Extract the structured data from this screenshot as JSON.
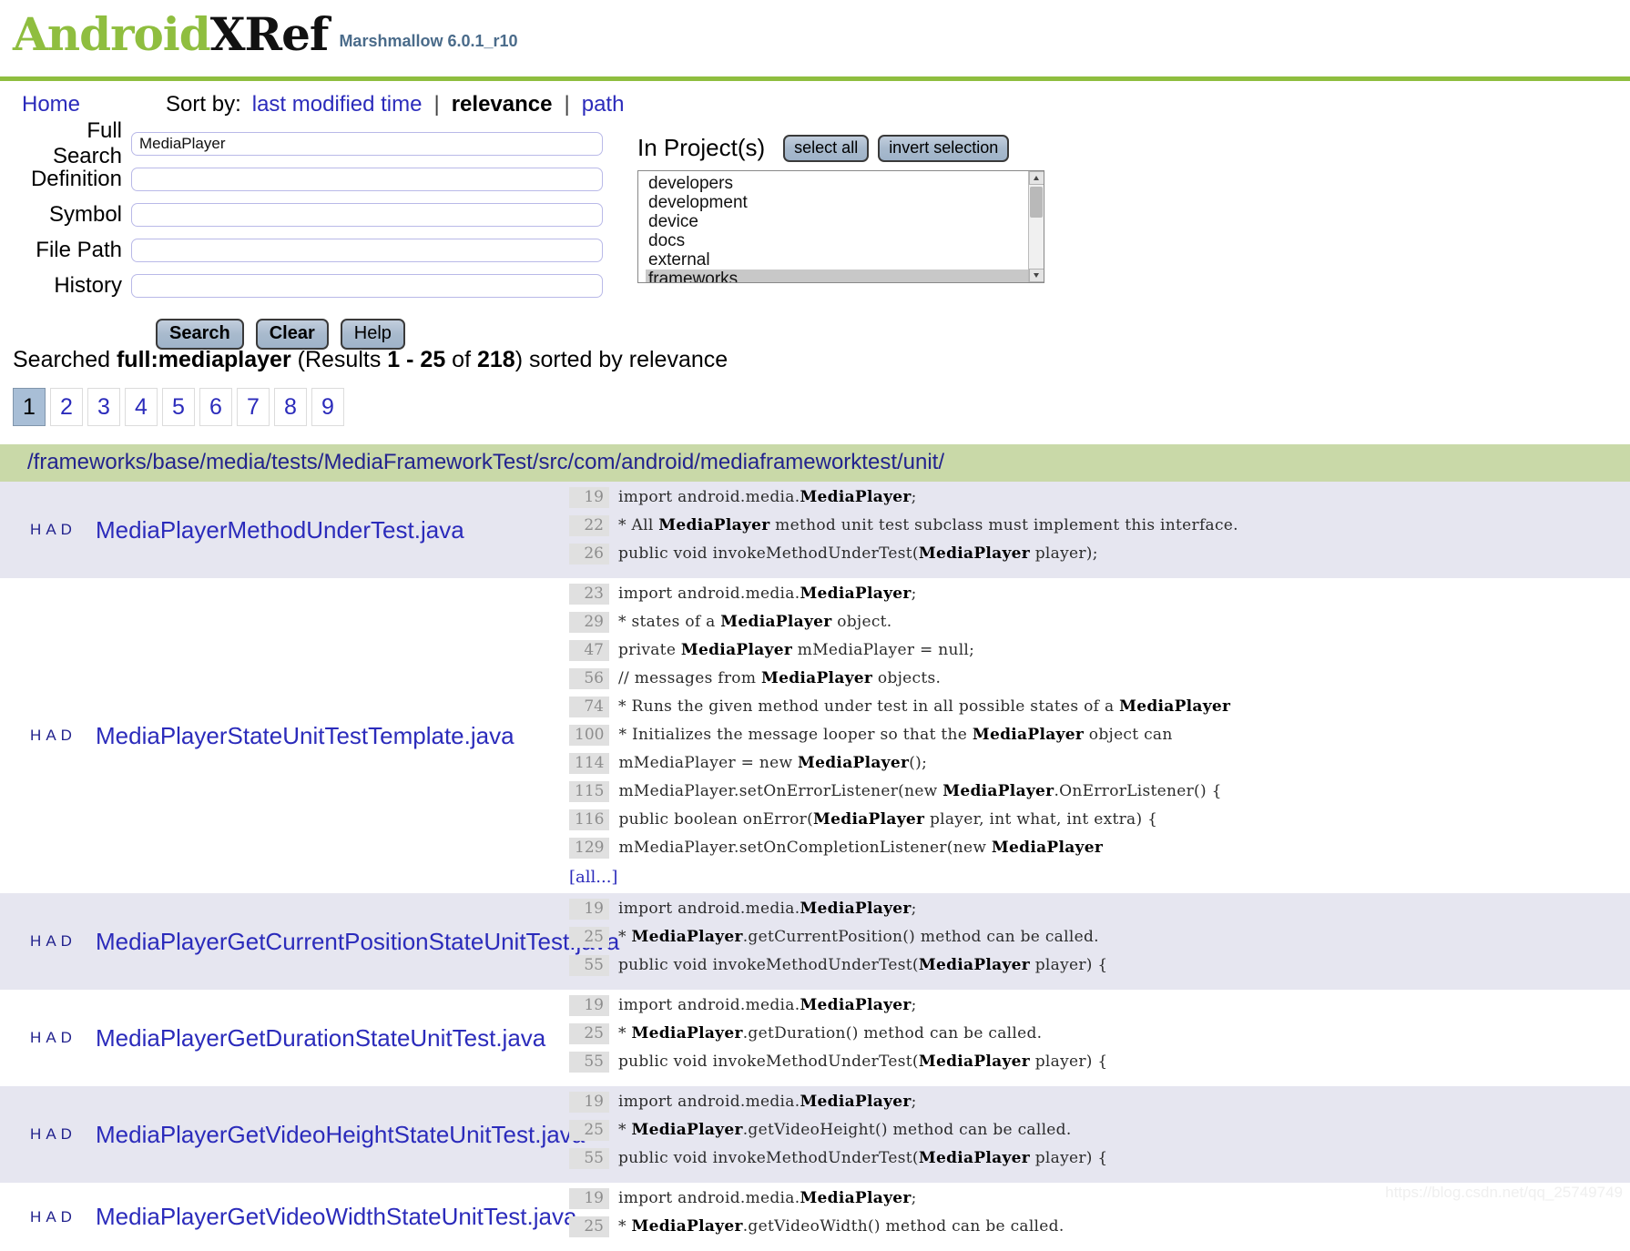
{
  "header": {
    "logo_primary": "Android",
    "logo_secondary": "XRef",
    "version": "Marshmallow 6.0.1_r10",
    "brand_color": "#8fbe3f"
  },
  "nav": {
    "home": "Home",
    "sort_label": "Sort by:",
    "sort_options": [
      {
        "label": "last modified time",
        "current": false
      },
      {
        "label": "relevance",
        "current": true
      },
      {
        "label": "path",
        "current": false
      }
    ],
    "separator": "|"
  },
  "search_form": {
    "fields": [
      {
        "label": "Full Search",
        "value": "MediaPlayer",
        "placeholder": ""
      },
      {
        "label": "Definition",
        "value": "",
        "placeholder": ""
      },
      {
        "label": "Symbol",
        "value": "",
        "placeholder": ""
      },
      {
        "label": "File Path",
        "value": "",
        "placeholder": ""
      },
      {
        "label": "History",
        "value": "",
        "placeholder": ""
      }
    ],
    "buttons": [
      {
        "label": "Search",
        "bold": true
      },
      {
        "label": "Clear",
        "bold": true
      },
      {
        "label": "Help",
        "bold": false
      }
    ]
  },
  "projects": {
    "title": "In Project(s)",
    "select_all": "select all",
    "invert_selection": "invert selection",
    "items": [
      {
        "label": "developers",
        "selected": false
      },
      {
        "label": "development",
        "selected": false
      },
      {
        "label": "device",
        "selected": false
      },
      {
        "label": "docs",
        "selected": false
      },
      {
        "label": "external",
        "selected": false
      },
      {
        "label": "frameworks",
        "selected": true
      }
    ]
  },
  "summary": {
    "prefix": "Searched ",
    "query": "full:mediaplayer",
    "results_open": " (Results ",
    "range": "1 - 25",
    "of": " of ",
    "total": "218",
    "suffix": ") sorted by relevance"
  },
  "pagination": {
    "pages": [
      "1",
      "2",
      "3",
      "4",
      "5",
      "6",
      "7",
      "8",
      "9"
    ],
    "current": "1"
  },
  "results": {
    "directory": "/frameworks/base/media/tests/MediaFrameworkTest/src/com/android/mediaframeworktest/unit/",
    "markers": [
      "H",
      "A",
      "D"
    ],
    "more_label": "[all...]",
    "rows": [
      {
        "file": "MediaPlayerMethodUnderTest.java",
        "alt": true,
        "more": false,
        "lines": [
          {
            "num": "19",
            "pre": "import android.media.",
            "hit": "MediaPlayer",
            "post": ";"
          },
          {
            "num": "22",
            "pre": "* All ",
            "hit": "MediaPlayer",
            "post": " method unit test subclass must implement this interface."
          },
          {
            "num": "26",
            "pre": "public void invokeMethodUnderTest(",
            "hit": "MediaPlayer",
            "post": " player);"
          }
        ]
      },
      {
        "file": "MediaPlayerStateUnitTestTemplate.java",
        "alt": false,
        "more": true,
        "lines": [
          {
            "num": "23",
            "pre": "import android.media.",
            "hit": "MediaPlayer",
            "post": ";"
          },
          {
            "num": "29",
            "pre": "* states of a ",
            "hit": "MediaPlayer",
            "post": " object."
          },
          {
            "num": "47",
            "pre": "private ",
            "hit": "MediaPlayer",
            "post": " mMediaPlayer = null;"
          },
          {
            "num": "56",
            "pre": "// messages from ",
            "hit": "MediaPlayer",
            "post": " objects."
          },
          {
            "num": "74",
            "pre": "* Runs the given method under test in all possible states of a ",
            "hit": "MediaPlayer",
            "post": ""
          },
          {
            "num": "100",
            "pre": "* Initializes the message looper so that the ",
            "hit": "MediaPlayer",
            "post": " object can"
          },
          {
            "num": "114",
            "pre": "mMediaPlayer = new ",
            "hit": "MediaPlayer",
            "post": "();"
          },
          {
            "num": "115",
            "pre": "mMediaPlayer.setOnErrorListener(new ",
            "hit": "MediaPlayer",
            "post": ".OnErrorListener() {"
          },
          {
            "num": "116",
            "pre": "public boolean onError(",
            "hit": "MediaPlayer",
            "post": " player, int what, int extra) {"
          },
          {
            "num": "129",
            "pre": "mMediaPlayer.setOnCompletionListener(new ",
            "hit": "MediaPlayer",
            "post": ""
          }
        ]
      },
      {
        "file": "MediaPlayerGetCurrentPositionStateUnitTest.java",
        "alt": true,
        "more": false,
        "lines": [
          {
            "num": "19",
            "pre": "import android.media.",
            "hit": "MediaPlayer",
            "post": ";"
          },
          {
            "num": "25",
            "pre": "* ",
            "hit": "MediaPlayer",
            "post": ".getCurrentPosition() method can be called."
          },
          {
            "num": "55",
            "pre": "public void invokeMethodUnderTest(",
            "hit": "MediaPlayer",
            "post": " player) {"
          }
        ]
      },
      {
        "file": "MediaPlayerGetDurationStateUnitTest.java",
        "alt": false,
        "more": false,
        "lines": [
          {
            "num": "19",
            "pre": "import android.media.",
            "hit": "MediaPlayer",
            "post": ";"
          },
          {
            "num": "25",
            "pre": "* ",
            "hit": "MediaPlayer",
            "post": ".getDuration() method can be called."
          },
          {
            "num": "55",
            "pre": "public void invokeMethodUnderTest(",
            "hit": "MediaPlayer",
            "post": " player) {"
          }
        ]
      },
      {
        "file": "MediaPlayerGetVideoHeightStateUnitTest.java",
        "alt": true,
        "more": false,
        "lines": [
          {
            "num": "19",
            "pre": "import android.media.",
            "hit": "MediaPlayer",
            "post": ";"
          },
          {
            "num": "25",
            "pre": "* ",
            "hit": "MediaPlayer",
            "post": ".getVideoHeight() method can be called."
          },
          {
            "num": "55",
            "pre": "public void invokeMethodUnderTest(",
            "hit": "MediaPlayer",
            "post": " player) {"
          }
        ]
      },
      {
        "file": "MediaPlayerGetVideoWidthStateUnitTest.java",
        "alt": false,
        "more": false,
        "lines": [
          {
            "num": "19",
            "pre": "import android.media.",
            "hit": "MediaPlayer",
            "post": ";"
          },
          {
            "num": "25",
            "pre": "* ",
            "hit": "MediaPlayer",
            "post": ".getVideoWidth() method can be called."
          }
        ]
      }
    ]
  },
  "watermark": "https://blog.csdn.net/qq_25749749"
}
